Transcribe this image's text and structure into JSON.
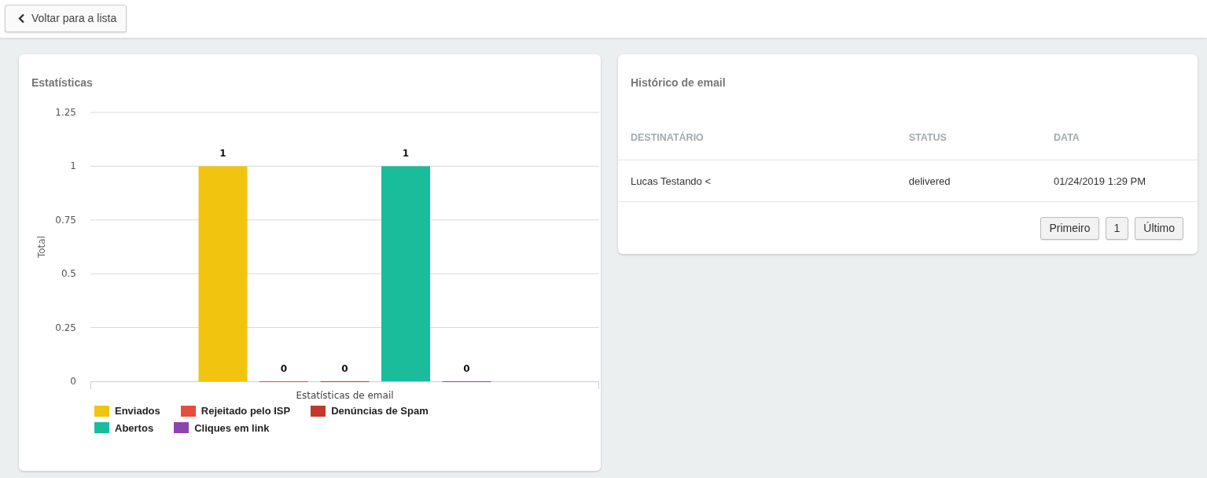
{
  "back_button": {
    "label": "Voltar para a lista"
  },
  "stats_card": {
    "title": "Estatísticas",
    "chart_data": {
      "type": "bar",
      "ylabel": "Total",
      "grid": true,
      "categories": [
        "Estatísticas de email"
      ],
      "ylim": [
        0,
        1.25
      ],
      "yticks": [
        0,
        0.25,
        0.5,
        0.75,
        1,
        1.25
      ],
      "series": [
        {
          "name": "Enviados",
          "color": "#f1c40f",
          "values": [
            1
          ],
          "value_labels": [
            "1"
          ]
        },
        {
          "name": "Rejeitado pelo ISP",
          "color": "#e74c3c",
          "values": [
            0
          ],
          "value_labels": [
            "0"
          ]
        },
        {
          "name": "Denúncias de Spam",
          "color": "#c0392b",
          "values": [
            0
          ],
          "value_labels": [
            "0"
          ]
        },
        {
          "name": "Abertos",
          "color": "#1abc9c",
          "values": [
            1
          ],
          "value_labels": [
            "1"
          ]
        },
        {
          "name": "Cliques em link",
          "color": "#8e44ad",
          "values": [
            0
          ],
          "value_labels": [
            "0"
          ]
        }
      ]
    }
  },
  "history_card": {
    "title": "Histórico de email",
    "table": {
      "columns": [
        "DESTINATÁRIO",
        "STATUS",
        "DATA"
      ],
      "rows": [
        [
          "Lucas Testando <",
          "delivered",
          "01/24/2019 1:29 PM"
        ]
      ]
    },
    "pagination": [
      "Primeiro",
      "1",
      "Último"
    ]
  }
}
